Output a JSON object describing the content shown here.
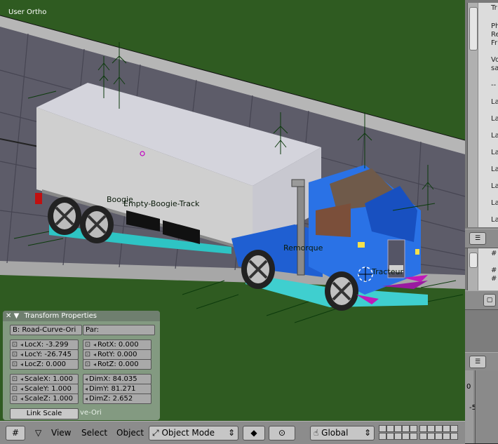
{
  "viewport": {
    "label": "User Ortho",
    "scene_labels": {
      "boogie": "Boogie",
      "empty_boogie_track": "Empty-Boogie-Track",
      "remorque": "Remorque",
      "tracteur": "Tracteur"
    }
  },
  "text_editor": {
    "lines": [
      "Tr",
      "Ph",
      "Re",
      "Fr",
      "Vo",
      "sa",
      "--",
      "La",
      "La",
      "La",
      "La",
      "La",
      "La",
      "La",
      "La",
      "La"
    ],
    "second_lines": [
      "#",
      "#",
      "#"
    ]
  },
  "transform_panel": {
    "title": "Transform Properties",
    "object_name": "B: Road-Curve-Ori",
    "parent": "Par:",
    "loc": {
      "x": "LocX: -3.299",
      "y": "LocY: -26.745",
      "z": "LocZ: 0.000"
    },
    "rot": {
      "x": "RotX: 0.000",
      "y": "RotY: 0.000",
      "z": "RotZ: 0.000"
    },
    "scale": {
      "x": "ScaleX: 1.000",
      "y": "ScaleY: 1.000",
      "z": "ScaleZ: 1.000"
    },
    "dim": {
      "x": "DimX: 84.035",
      "y": "DimY: 81.271",
      "z": "DimZ: 2.652"
    },
    "link_scale": "Link Scale",
    "trailing_text": "ve-Ori"
  },
  "header": {
    "menus": [
      "View",
      "Select",
      "Object"
    ],
    "mode": "Object Mode",
    "orientation": "Global"
  },
  "graph_axis": {
    "labels": [
      "0",
      "-5"
    ]
  }
}
